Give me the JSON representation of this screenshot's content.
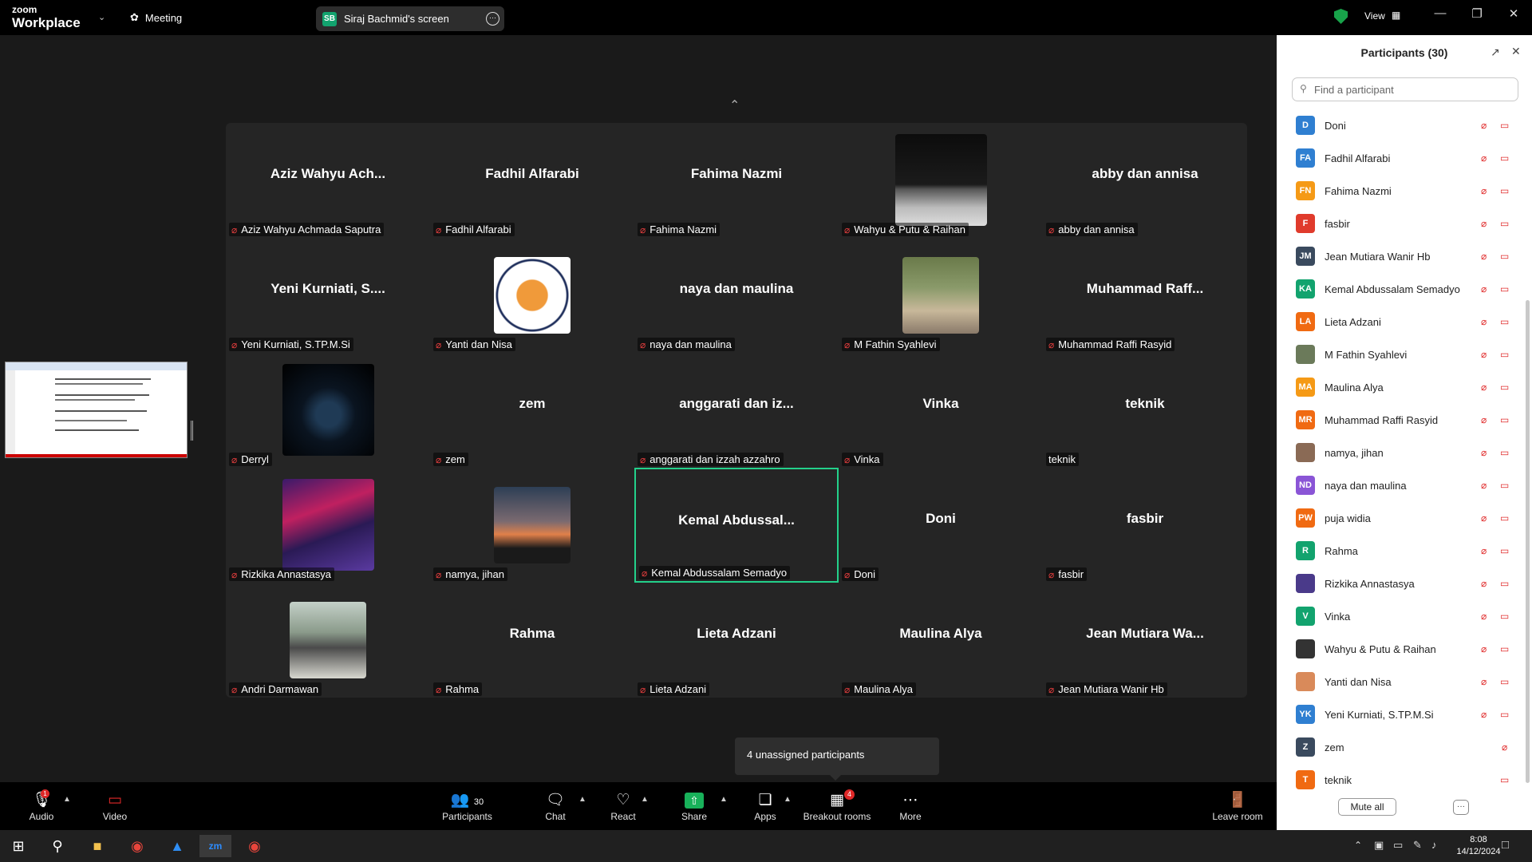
{
  "app": {
    "brand_top": "zoom",
    "brand_bottom": "Workplace",
    "meeting_label": "Meeting",
    "view_label": "View"
  },
  "share": {
    "badge": "SB",
    "title": "Siraj Bachmid's screen"
  },
  "tiles": [
    {
      "big": "Aziz Wahyu  Ach...",
      "label": "Aziz Wahyu  Achmada Saputra",
      "muted": true
    },
    {
      "big": "Fadhil Alfarabi",
      "label": "Fadhil Alfarabi",
      "muted": true
    },
    {
      "big": "Fahima Nazmi",
      "label": "Fahima Nazmi",
      "muted": true
    },
    {
      "big": "",
      "label": "Wahyu & Putu & Raihan",
      "muted": true,
      "photo": "car"
    },
    {
      "big": "abby dan annisa",
      "label": "abby dan annisa",
      "muted": true
    },
    {
      "big": "Yeni Kurniati, S....",
      "label": "Yeni Kurniati, S.TP.M.Si",
      "muted": true
    },
    {
      "big": "",
      "label": "Yanti dan Nisa",
      "muted": true,
      "photo": "plate"
    },
    {
      "big": "naya dan maulina",
      "label": "naya dan maulina",
      "muted": true
    },
    {
      "big": "",
      "label": "M Fathin Syahlevi",
      "muted": true,
      "photo": "park"
    },
    {
      "big": "Muhammad  Raff...",
      "label": "Muhammad Raffi Rasyid",
      "muted": true
    },
    {
      "big": "",
      "label": "Derryl",
      "muted": true,
      "photo": "dark"
    },
    {
      "big": "zem",
      "label": "zem",
      "muted": true
    },
    {
      "big": "anggarati dan iz...",
      "label": "anggarati dan izzah azzahro",
      "muted": true
    },
    {
      "big": "Vinka",
      "label": "Vinka",
      "muted": true
    },
    {
      "big": "teknik",
      "label": "teknik",
      "muted": false
    },
    {
      "big": "",
      "label": "Rizkika Annastasya",
      "muted": true,
      "photo": "punk"
    },
    {
      "big": "",
      "label": "namya, jihan",
      "muted": true,
      "photo": "sunset"
    },
    {
      "big": "Kemal  Abdussal...",
      "label": "Kemal Abdussalam Semadyo",
      "muted": true,
      "active": true
    },
    {
      "big": "Doni",
      "label": "Doni",
      "muted": true
    },
    {
      "big": "fasbir",
      "label": "fasbir",
      "muted": true
    },
    {
      "big": "",
      "label": "Andri Darmawan",
      "muted": true,
      "photo": "person"
    },
    {
      "big": "Rahma",
      "label": "Rahma",
      "muted": true
    },
    {
      "big": "Lieta Adzani",
      "label": "Lieta Adzani",
      "muted": true
    },
    {
      "big": "Maulina Alya",
      "label": "Maulina Alya",
      "muted": true
    },
    {
      "big": "Jean Mutiara Wa...",
      "label": "Jean Mutiara Wanir Hb",
      "muted": true
    }
  ],
  "toast": "4 unassigned participants",
  "toolbar": {
    "audio": "Audio",
    "video": "Video",
    "participants": "Participants",
    "participants_count": "30",
    "chat": "Chat",
    "react": "React",
    "share": "Share",
    "apps": "Apps",
    "breakout": "Breakout rooms",
    "breakout_badge": "4",
    "more": "More",
    "leave": "Leave room",
    "audio_badge": "1"
  },
  "panel": {
    "title": "Participants (30)",
    "search_placeholder": "Find a participant",
    "mute_all": "Mute all",
    "participants": [
      {
        "initials": "D",
        "name": "Doni",
        "color": "#2f7fd1",
        "video_off": true
      },
      {
        "initials": "FA",
        "name": "Fadhil Alfarabi",
        "color": "#2f7fd1",
        "video_off": true
      },
      {
        "initials": "FN",
        "name": "Fahima Nazmi",
        "color": "#f59a16",
        "video_off": true
      },
      {
        "initials": "F",
        "name": "fasbir",
        "color": "#e03b2c",
        "video_off": true
      },
      {
        "initials": "JM",
        "name": "Jean Mutiara Wanir Hb",
        "color": "#3a4a5e",
        "video_off": true
      },
      {
        "initials": "KA",
        "name": "Kemal Abdussalam Semadyo",
        "color": "#12a36e",
        "video_off": true
      },
      {
        "initials": "LA",
        "name": "Lieta Adzani",
        "color": "#f06a12",
        "video_off": true
      },
      {
        "initials": "",
        "name": "M Fathin Syahlevi",
        "color": "#6b7a5a",
        "video_off": true
      },
      {
        "initials": "MA",
        "name": "Maulina Alya",
        "color": "#f59a16",
        "video_off": true
      },
      {
        "initials": "MR",
        "name": "Muhammad Raffi Rasyid",
        "color": "#f06a12",
        "video_off": true
      },
      {
        "initials": "",
        "name": "namya, jihan",
        "color": "#8a6a55",
        "video_off": true
      },
      {
        "initials": "ND",
        "name": "naya dan maulina",
        "color": "#8a55d6",
        "video_off": true
      },
      {
        "initials": "PW",
        "name": "puja widia",
        "color": "#f06a12",
        "video_off": true
      },
      {
        "initials": "R",
        "name": "Rahma",
        "color": "#12a36e",
        "video_off": true
      },
      {
        "initials": "",
        "name": "Rizkika Annastasya",
        "color": "#4a3a8a",
        "video_off": true
      },
      {
        "initials": "V",
        "name": "Vinka",
        "color": "#12a36e",
        "video_off": true
      },
      {
        "initials": "",
        "name": "Wahyu & Putu & Raihan",
        "color": "#333333",
        "video_off": true
      },
      {
        "initials": "",
        "name": "Yanti dan Nisa",
        "color": "#d98a5a",
        "video_off": true
      },
      {
        "initials": "YK",
        "name": "Yeni Kurniati, S.TP.M.Si",
        "color": "#2f7fd1",
        "video_off": true
      },
      {
        "initials": "Z",
        "name": "zem",
        "color": "#3a4a5e",
        "video_off": false
      },
      {
        "initials": "T",
        "name": "teknik",
        "color": "#f06a12",
        "video_off": true,
        "no_mic": true
      }
    ]
  },
  "taskbar": {
    "time": "8:08",
    "date": "14/12/2024"
  }
}
